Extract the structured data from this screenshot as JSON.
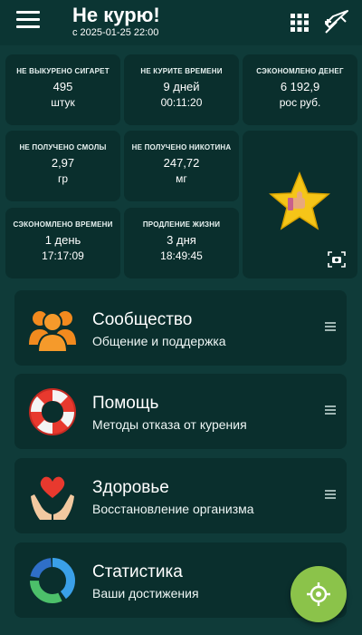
{
  "header": {
    "title": "Не курю!",
    "subtitle": "с 2025-01-25 22:00",
    "menu_icon": "hamburger-menu-icon",
    "grid_icon": "grid-icon",
    "pen_icon": "feather-pen-icon"
  },
  "stats": [
    {
      "label": "НЕ ВЫКУРЕНО СИГАРЕТ",
      "value": "495",
      "unit": "штук"
    },
    {
      "label": "НЕ КУРИТЕ ВРЕМЕНИ",
      "value": "9 дней",
      "unit": "00:11:20"
    },
    {
      "label": "СЭКОНОМЛЕНО ДЕНЕГ",
      "value": "6 192,9",
      "unit": "рос руб."
    },
    {
      "label": "НЕ ПОЛУЧЕНО СМОЛЫ",
      "value": "2,97",
      "unit": "гр"
    },
    {
      "label": "НЕ ПОЛУЧЕНО НИКОТИНА",
      "value": "247,72",
      "unit": "мг"
    },
    {
      "label": "СЭКОНОМЛЕНО ВРЕМЕНИ",
      "value": "1 день",
      "unit": "17:17:09"
    },
    {
      "label": "ПРОДЛЕНИЕ ЖИЗНИ",
      "value": "3 дня",
      "unit": "18:49:45"
    }
  ],
  "achievement": {
    "icon": "star-thumbs-up-icon",
    "camera_icon": "camera-icon"
  },
  "menu": [
    {
      "title": "Сообщество",
      "subtitle": "Общение и поддержка",
      "icon": "community-people-icon"
    },
    {
      "title": "Помощь",
      "subtitle": "Методы отказа от курения",
      "icon": "lifebuoy-icon"
    },
    {
      "title": "Здоровье",
      "subtitle": "Восстановление организма",
      "icon": "heart-hands-icon"
    },
    {
      "title": "Статистика",
      "subtitle": "Ваши достижения",
      "icon": "donut-chart-icon"
    }
  ],
  "fab": {
    "icon": "crosshair-target-icon"
  },
  "colors": {
    "background": "#0f3b39",
    "card": "#0a2f2d",
    "accent_green": "#8bc34a",
    "star_yellow": "#f5c518"
  }
}
